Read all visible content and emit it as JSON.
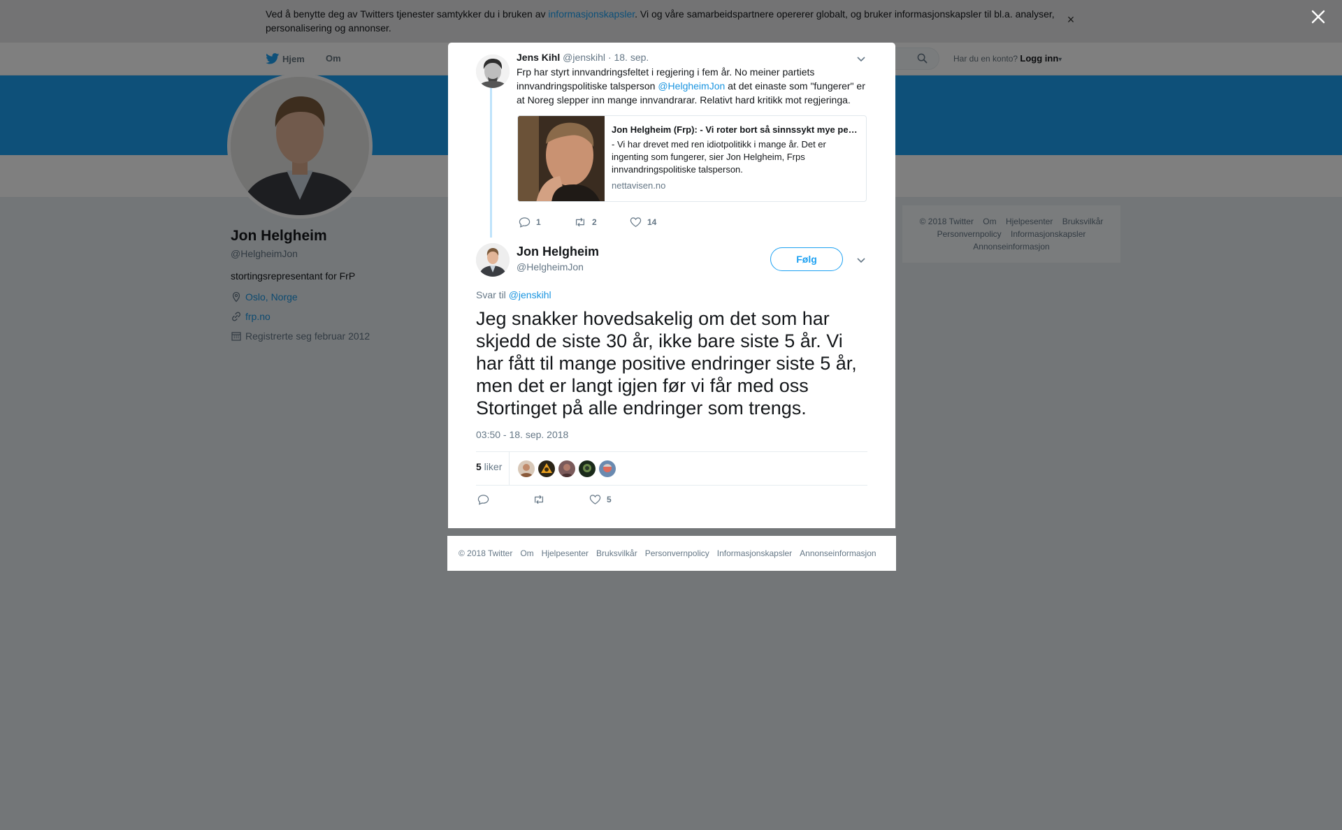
{
  "cookie_banner": {
    "text_before": "Ved å benytte deg av Twitters tjenester samtykker du i bruken av ",
    "link": "informasjonskapsler",
    "text_after": ". Vi og våre samarbeidspartnere opererer globalt, og bruker informasjonskapsler til bl.a. analyser, personalisering og annonser.",
    "close": "×"
  },
  "nav": {
    "home": "Hjem",
    "about": "Om",
    "have_account": "Har du en konto?",
    "login": "Logg inn",
    "login_caret": "▾"
  },
  "profile": {
    "name": "Jon Helgheim",
    "handle": "@HelgheimJon",
    "bio": "stortingsrepresentant for FrP",
    "location": "Oslo, Norge",
    "website": "frp.no",
    "joined": "Registrerte seg februar 2012"
  },
  "side_footer": {
    "items": [
      "© 2018 Twitter",
      "Om",
      "Hjelpesenter",
      "Bruksvilkår",
      "Personvernpolicy",
      "Informasjonskapsler",
      "Annonseinformasjon"
    ]
  },
  "parent_tweet": {
    "name": "Jens Kihl",
    "handle": "@jenskihl",
    "date": "· 18. sep.",
    "text_1": "Frp har styrt innvandringsfeltet i regjering i fem år. No meiner partiets innvandringspolitiske talsperson ",
    "mention": "@HelgheimJon",
    "text_2": " at det einaste som \"fungerer\" er at Noreg slepper inn mange innvandrarar. Relativt hard kritikk mot regjeringa.",
    "card": {
      "title": "Jon Helgheim (Frp): - Vi roter bort så sinnssykt mye penger",
      "description": "- Vi har drevet med ren idiotpolitikk i mange år. Det er ingenting som fungerer, sier Jon Helgheim,  Frps innvandringspolitiske talsperson.",
      "domain": "nettavisen.no"
    },
    "replies": "1",
    "retweets": "2",
    "likes": "14"
  },
  "main_tweet": {
    "name": "Jon Helgheim",
    "handle": "@HelgheimJon",
    "follow_label": "Følg",
    "reply_prefix": "Svar til ",
    "reply_mention": "@jenskihl",
    "text": "Jeg snakker hovedsakelig om det som har skjedd de siste 30 år, ikke bare siste 5 år. Vi har fått til mange positive endringer siste 5 år, men det er langt igjen før vi får med oss Stortinget på alle endringer som trengs.",
    "timestamp": "03:50 - 18. sep. 2018",
    "likes_count": "5",
    "likes_label": " liker",
    "action_likes": "5"
  },
  "modal_footer": {
    "items": [
      "© 2018 Twitter",
      "Om",
      "Hjelpesenter",
      "Bruksvilkår",
      "Personvernpolicy",
      "Informasjonskapsler",
      "Annonseinformasjon"
    ]
  },
  "colors": {
    "accent": "#1da1f2",
    "link": "#1b95e0",
    "muted": "#657786",
    "overlay": "#7f7f7f"
  },
  "icons": [
    "twitter-bird-icon",
    "search-icon",
    "location-pin-icon",
    "link-icon",
    "calendar-icon",
    "chevron-down-icon",
    "reply-icon",
    "retweet-icon",
    "heart-icon",
    "close-icon"
  ]
}
